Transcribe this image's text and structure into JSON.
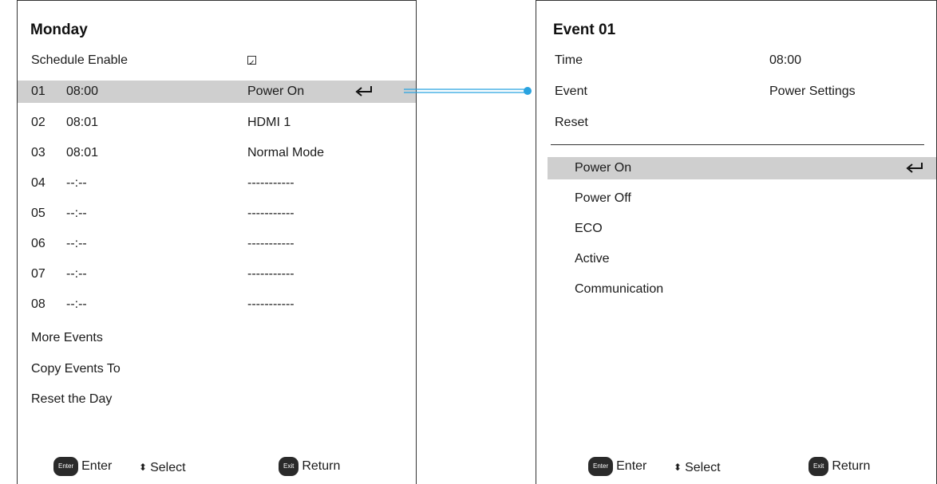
{
  "left": {
    "title": "Monday",
    "schedule_enable_label": "Schedule Enable",
    "schedule_enable_checked": true,
    "events": [
      {
        "num": "01",
        "time": "08:00",
        "action": "Power On"
      },
      {
        "num": "02",
        "time": "08:01",
        "action": "HDMI 1"
      },
      {
        "num": "03",
        "time": "08:01",
        "action": "Normal Mode"
      },
      {
        "num": "04",
        "time": "--:--",
        "action": "-----------"
      },
      {
        "num": "05",
        "time": "--:--",
        "action": "-----------"
      },
      {
        "num": "06",
        "time": "--:--",
        "action": "-----------"
      },
      {
        "num": "07",
        "time": "--:--",
        "action": "-----------"
      },
      {
        "num": "08",
        "time": "--:--",
        "action": "-----------"
      }
    ],
    "more_events": "More Events",
    "copy_events": "Copy Events To",
    "reset_day": "Reset the Day",
    "footer": {
      "enter_pill": "Enter",
      "enter": "Enter",
      "select": "Select",
      "exit_pill": "Exit",
      "return": "Return"
    }
  },
  "right": {
    "title": "Event 01",
    "time_label": "Time",
    "time_value": "08:00",
    "event_label": "Event",
    "event_value": "Power Settings",
    "reset_label": "Reset",
    "options": [
      "Power On",
      "Power Off",
      "ECO",
      "Active",
      "Communication"
    ],
    "footer": {
      "enter_pill": "Enter",
      "enter": "Enter",
      "select": "Select",
      "exit_pill": "Exit",
      "return": "Return"
    }
  },
  "colors": {
    "highlight": "#cfcfcf",
    "connector": "#29a3e0",
    "text": "#1a1a1a"
  },
  "icons": {
    "enter": "return-arrow-icon",
    "select": "up-down-arrows-icon",
    "check": "checkmark-icon"
  }
}
